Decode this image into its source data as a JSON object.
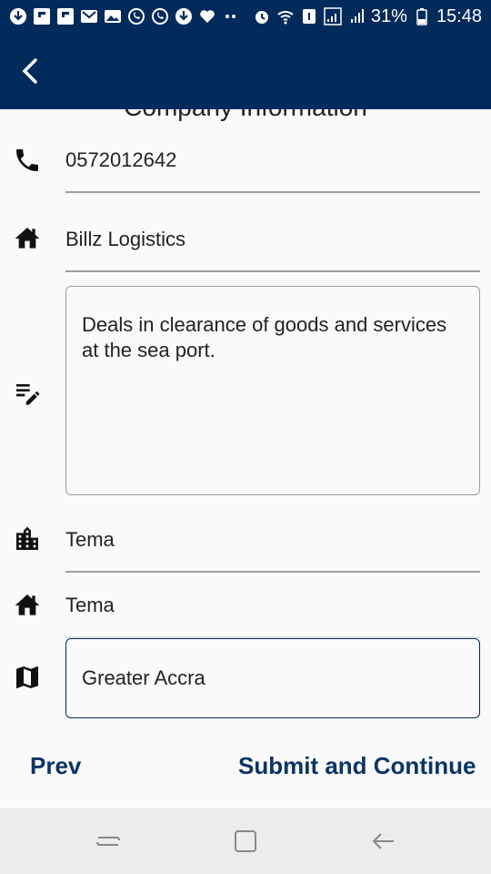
{
  "status_bar": {
    "battery_percent": "31%",
    "time": "15:48",
    "left_icons": [
      "download-icon",
      "flipboard-icon",
      "flipboard-icon",
      "gmail-icon",
      "gallery-icon",
      "whatsapp-icon",
      "whatsapp-icon",
      "download-icon",
      "heart-icon",
      "more-dots-icon"
    ],
    "right_icons": [
      "alarm-icon",
      "wifi-icon",
      "sim-1-icon",
      "signal-icon",
      "signal-icon",
      "battery-icon"
    ]
  },
  "app_bar": {
    "back_icon": "chevron-left-icon"
  },
  "form": {
    "section_title": "Company Information",
    "phone": "0572012642",
    "company_name": "Billz Logistics",
    "description": "Deals in clearance of goods and services at the sea port.",
    "city": "Tema",
    "town": "Tema",
    "region": "Greater Accra"
  },
  "actions": {
    "prev_label": "Prev",
    "submit_label": "Submit and Continue"
  },
  "colors": {
    "primary": "#022a5a",
    "button_text": "#0b3366",
    "background": "#fafafa",
    "divider": "#9e9e9e"
  }
}
